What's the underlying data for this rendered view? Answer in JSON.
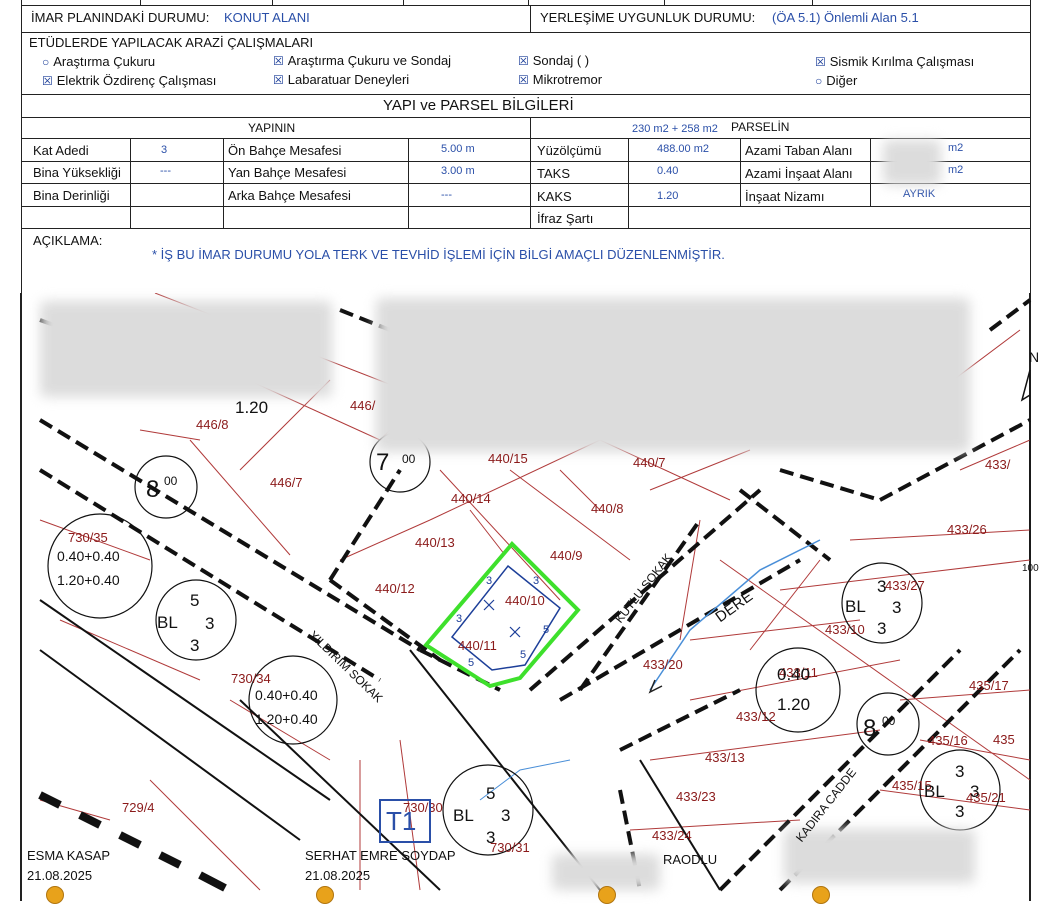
{
  "header": {
    "imar_label": "İMAR PLANINDAKİ DURUMU:",
    "imar_value": "KONUT ALANI",
    "yerlesim_label": "YERLEŞİME UYGUNLUK DURUMU:",
    "yerlesim_value": "(ÖA 5.1) Önlemli Alan 5.1"
  },
  "etud": {
    "title": "ETÜDLERDE YAPILACAK ARAZİ ÇALIŞMALARI",
    "items": [
      {
        "mark": "○",
        "label": "Araştırma Çukuru"
      },
      {
        "mark": "☒",
        "label": "Araştırma Çukuru ve Sondaj"
      },
      {
        "mark": "☒",
        "label": "Sondaj ( )"
      },
      {
        "mark": "☒",
        "label": "Sismik Kırılma Çalışması"
      },
      {
        "mark": "☒",
        "label": "Elektrik Özdirenç Çalışması"
      },
      {
        "mark": "☒",
        "label": "Labaratuar Deneyleri"
      },
      {
        "mark": "☒",
        "label": "Mikrotremor"
      },
      {
        "mark": "○",
        "label": "Diğer"
      }
    ]
  },
  "yapi": {
    "title": "YAPI ve PARSEL BİLGİLERİ",
    "yapinin": "YAPININ",
    "parsel_area": "230 m2 + 258 m2",
    "parselin": "PARSELİN",
    "rows": [
      [
        "Kat Adedi",
        "3",
        "Ön Bahçe Mesafesi",
        "5.00 m",
        "Yüzölçümü",
        "488.00 m2",
        "Azami Taban Alanı",
        "m2"
      ],
      [
        "Bina Yüksekliği",
        "---",
        "Yan Bahçe Mesafesi",
        "3.00 m",
        "TAKS",
        "0.40",
        "Azami İnşaat Alanı",
        "m2"
      ],
      [
        "Bina Derinliği",
        "",
        "Arka Bahçe Mesafesi",
        "---",
        "KAKS",
        "1.20",
        "İnşaat Nizamı",
        "AYRIK"
      ],
      [
        "",
        "",
        "",
        "",
        "İfraz Şartı",
        "",
        "",
        ""
      ]
    ]
  },
  "aciklama": {
    "label": "AÇIKLAMA:",
    "text": "* İŞ BU İMAR DURUMU  YOLA TERK VE TEVHİD İŞLEMİ İÇİN BİLGİ AMAÇLI DÜZENLENMİŞTİR."
  },
  "map": {
    "parcels": [
      "446/8",
      "446/7",
      "446/",
      "440/15",
      "440/7",
      "440/14",
      "440/13",
      "440/12",
      "440/10",
      "440/11",
      "440/9",
      "440/8",
      "433/26",
      "433/27",
      "433/10",
      "433/",
      "433/20",
      "433/12",
      "433/13",
      "433/23",
      "433/24",
      "435/17",
      "435/16",
      "435",
      "435/15",
      "435/21",
      "433/11",
      "730/35",
      "730/34",
      "730/30",
      "730/31",
      "729/4",
      "100"
    ],
    "streets": [
      "YILDIRIM SOKAK",
      "KUTLU SOKAK",
      "DERE",
      "KADIRA CADDE",
      "RAODLU"
    ],
    "density": [
      "0.40+0.40",
      "1.20+0.40",
      "0.40+0.40",
      "1.20+0.40"
    ],
    "ratios": [
      "1.20",
      "0.40",
      "1.20"
    ],
    "bl": [
      "BL",
      "BL",
      "BL",
      "BL"
    ],
    "numbers": [
      "5",
      "3",
      "3",
      "3",
      "3",
      "3",
      "5",
      "3",
      "3",
      "3",
      "3",
      "3"
    ],
    "setbacks": [
      "3",
      "3",
      "3",
      "5",
      "5",
      "5"
    ],
    "circles": [
      "8",
      "00",
      "8",
      "00",
      "7",
      "00"
    ],
    "t1": "T1",
    "north": "N",
    "signers": [
      {
        "name": "ESMA KASAP",
        "date": "21.08.2025"
      },
      {
        "name": "SERHAT EMRE SOYDAP",
        "date": "21.08.2025"
      }
    ]
  },
  "colors": {
    "accent_blue": "#2a4fa8",
    "parcel_red": "#8b1a1a",
    "highlight_green": "#3ee02c"
  }
}
